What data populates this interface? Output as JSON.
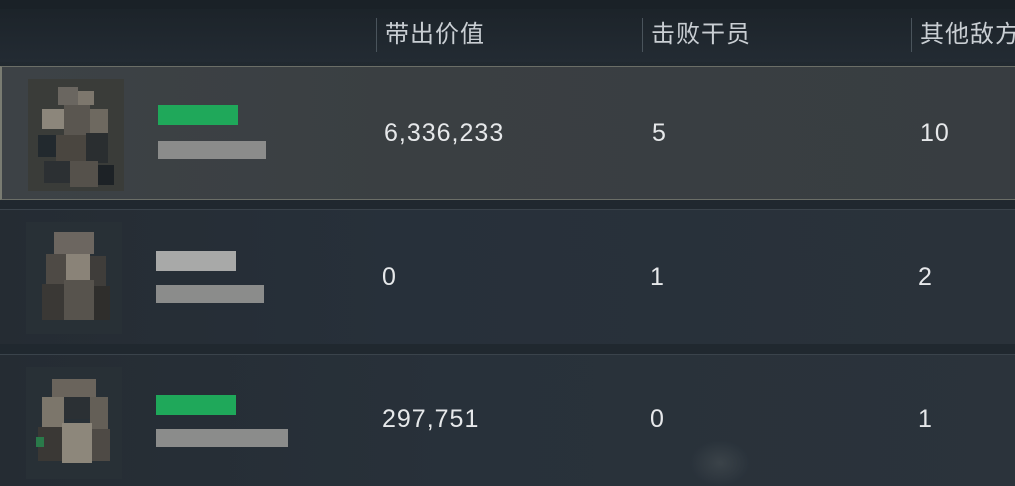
{
  "columns": {
    "value": "带出价值",
    "operators": "击败干员",
    "other_enemies": "其他敌方"
  },
  "rows": [
    {
      "value": "6,336,233",
      "operators": "5",
      "other_enemies": "10",
      "name_tag_color": "#1fa85a"
    },
    {
      "value": "0",
      "operators": "1",
      "other_enemies": "2",
      "name_tag_color": "#a8a9a8"
    },
    {
      "value": "297,751",
      "operators": "0",
      "other_enemies": "1",
      "name_tag_color": "#1fa85a"
    }
  ],
  "colors": {
    "background": "#1f262d",
    "highlight_row": "#3c4145",
    "accent_green": "#1fa85a"
  }
}
